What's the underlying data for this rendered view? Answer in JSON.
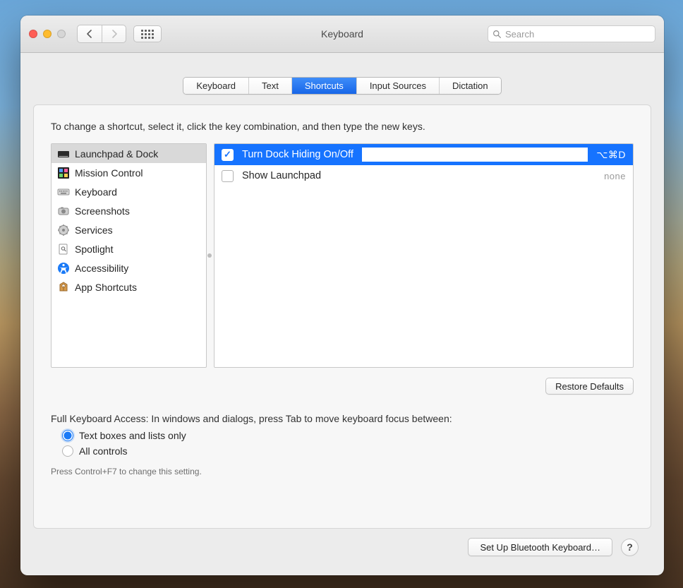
{
  "window": {
    "title": "Keyboard"
  },
  "search": {
    "placeholder": "Search",
    "value": ""
  },
  "tabs": [
    {
      "label": "Keyboard",
      "active": false
    },
    {
      "label": "Text",
      "active": false
    },
    {
      "label": "Shortcuts",
      "active": true
    },
    {
      "label": "Input Sources",
      "active": false
    },
    {
      "label": "Dictation",
      "active": false
    }
  ],
  "panel": {
    "instruction": "To change a shortcut, select it, click the key combination, and then type the new keys.",
    "categories": [
      {
        "label": "Launchpad & Dock",
        "icon": "dock-icon",
        "selected": true
      },
      {
        "label": "Mission Control",
        "icon": "mission-control-icon"
      },
      {
        "label": "Keyboard",
        "icon": "keyboard-icon"
      },
      {
        "label": "Screenshots",
        "icon": "camera-icon"
      },
      {
        "label": "Services",
        "icon": "gear-icon"
      },
      {
        "label": "Spotlight",
        "icon": "spotlight-icon"
      },
      {
        "label": "Accessibility",
        "icon": "accessibility-icon"
      },
      {
        "label": "App Shortcuts",
        "icon": "app-shortcuts-icon"
      }
    ],
    "shortcuts": [
      {
        "label": "Turn Dock Hiding On/Off",
        "checked": true,
        "keys": "⌥⌘D",
        "selected": true,
        "editing": true
      },
      {
        "label": "Show Launchpad",
        "checked": false,
        "keys": "none",
        "none": true
      }
    ],
    "restore_label": "Restore Defaults",
    "fka": {
      "heading": "Full Keyboard Access: In windows and dialogs, press Tab to move keyboard focus between:",
      "opt1": "Text boxes and lists only",
      "opt2": "All controls",
      "selected": 0,
      "hint": "Press Control+F7 to change this setting."
    }
  },
  "footer": {
    "bluetooth_label": "Set Up Bluetooth Keyboard…",
    "help": "?"
  }
}
